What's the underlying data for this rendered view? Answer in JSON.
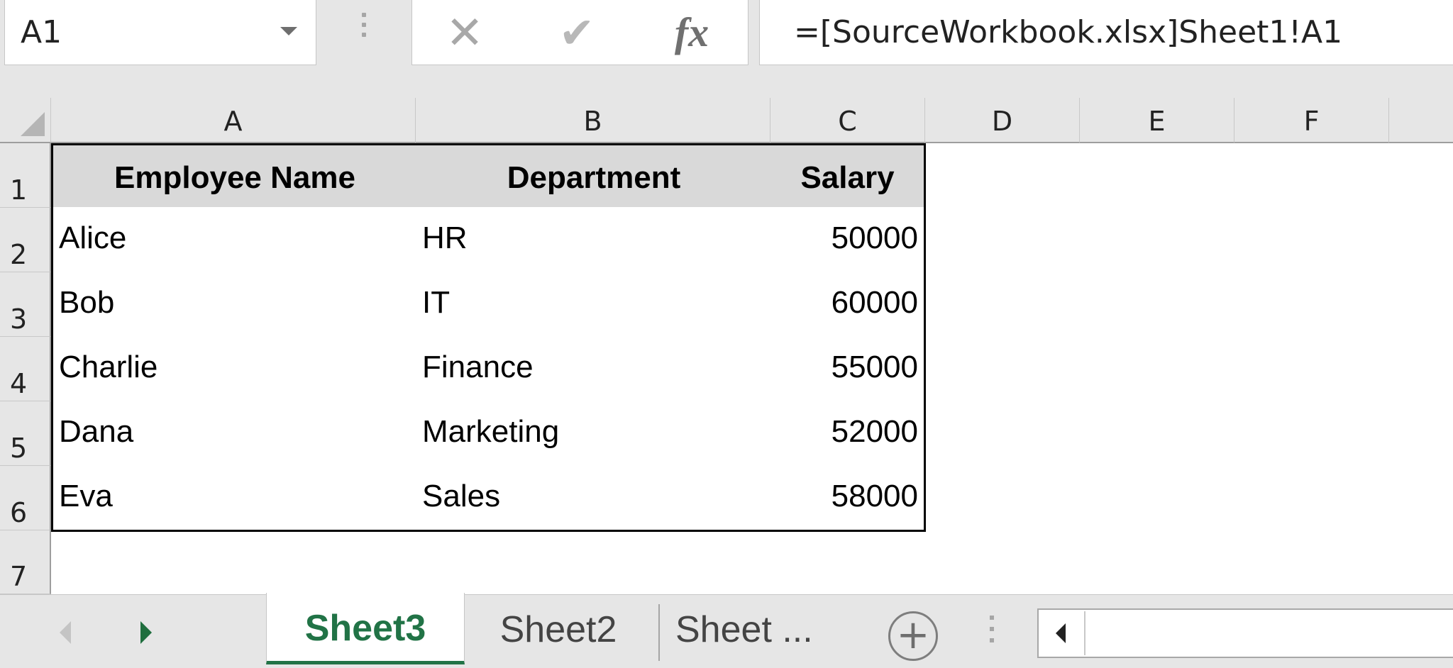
{
  "formula_bar": {
    "name_box": "A1",
    "cancel_icon": "✕",
    "enter_icon": "✔",
    "function_icon": "fx",
    "formula": "=[SourceWorkbook.xlsx]Sheet1!A1"
  },
  "columns": [
    "A",
    "B",
    "C",
    "D",
    "E",
    "F"
  ],
  "rows": [
    "1",
    "2",
    "3",
    "4",
    "5",
    "6",
    "7"
  ],
  "table": {
    "headers": [
      "Employee Name",
      "Department",
      "Salary"
    ],
    "rows": [
      [
        "Alice",
        "HR",
        "50000"
      ],
      [
        "Bob",
        "IT",
        "60000"
      ],
      [
        "Charlie",
        "Finance",
        "55000"
      ],
      [
        "Dana",
        "Marketing",
        "52000"
      ],
      [
        "Eva",
        "Sales",
        "58000"
      ]
    ]
  },
  "sheet_tabs": {
    "active": "Sheet3",
    "tabs": [
      "Sheet2",
      "Sheet ..."
    ],
    "add_icon": "+"
  },
  "colors": {
    "accent": "#217346",
    "header_fill": "#d9d9d9",
    "chrome": "#e6e6e6"
  }
}
